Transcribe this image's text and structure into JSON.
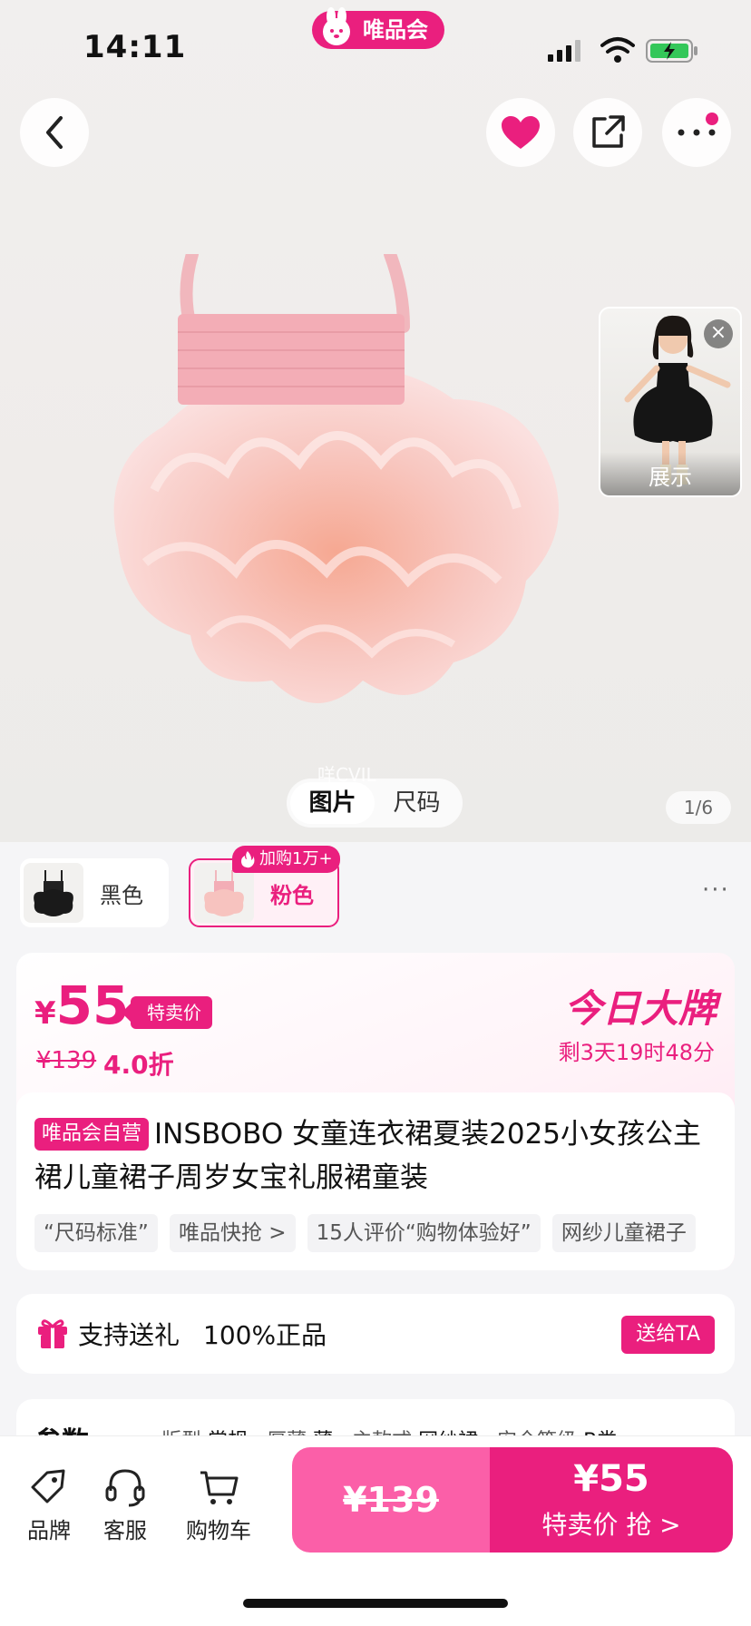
{
  "status_bar": {
    "time": "14:11",
    "brand": "唯品会"
  },
  "hero": {
    "thumbnail_label": "展示",
    "thumbnail_close": "×",
    "watermark": "咩CVIL",
    "tabs": [
      "图片",
      "尺码"
    ],
    "page_count": "1/6"
  },
  "colors": {
    "options": [
      "黑色",
      "粉色"
    ],
    "hot_tag": "加购1万+",
    "more": "···"
  },
  "price": {
    "yen": "¥",
    "value": "55",
    "sale_tag": "特卖价",
    "original": "¥139",
    "discount": "4.0折",
    "promo_title": "今日大牌",
    "countdown": "剩3天19时48分"
  },
  "product": {
    "self_tag": "唯品会自营",
    "title": "INSBOBO 女童连衣裙夏装2025小女孩公主裙儿童裙子周岁女宝礼服裙童装",
    "chips": [
      "“尺码标准”",
      "唯品快抢 >",
      "15人评价“购物体验好”",
      "网纱儿童裙子"
    ]
  },
  "gift": {
    "text": "支持送礼",
    "genuine": "100%正品",
    "button": "送给TA"
  },
  "params": {
    "title": "参数",
    "items": [
      {
        "key": "版型",
        "value": "常规"
      },
      {
        "key": "厚薄",
        "value": "薄"
      },
      {
        "key": "主款式",
        "value": "网纱裙"
      },
      {
        "key": "安全等级",
        "value": "B类"
      }
    ]
  },
  "bottom_bar": {
    "nav": [
      "品牌",
      "客服",
      "购物车"
    ],
    "orig_price": "¥139",
    "buy_price": "¥55",
    "buy_label": "特卖价 抢 >"
  },
  "colors_theme": {
    "accent": "#ea1f7e",
    "accent_light": "#fb5fa8"
  },
  "icons": [
    "back-icon",
    "heart-icon",
    "share-icon",
    "more-icon",
    "flame-icon",
    "gift-icon",
    "tag-icon",
    "headset-icon",
    "cart-icon"
  ]
}
